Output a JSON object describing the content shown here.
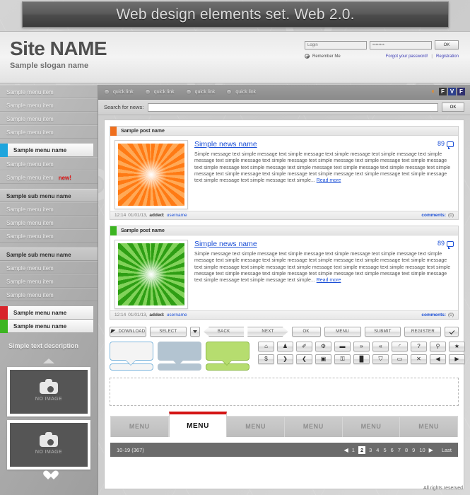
{
  "banner": {
    "title": "Web design elements set. Web 2.0."
  },
  "header": {
    "site_name": "Site NAME",
    "slogan": "Sample slogan name",
    "login": {
      "login_placeholder": "Login",
      "password_value": "••••••••",
      "ok_label": "OK",
      "remember_label": "Remember Me",
      "forgot_label": "Forgot your password!",
      "separator": "|",
      "registration_label": "Registration"
    }
  },
  "sidebar": {
    "top_items": [
      "Sample menu item",
      "Sample menu item",
      "Sample menu item",
      "Sample menu item"
    ],
    "active_item": {
      "label": "Sample menu name",
      "chip_color": "#1fa5dd"
    },
    "after_active_items": [
      {
        "label": "Sample menu item",
        "badge": ""
      },
      {
        "label": "Sample menu item",
        "badge": "new!"
      }
    ],
    "sub_sections": [
      {
        "heading": "Sample sub menu name",
        "items": [
          "Sample menu item",
          "Sample menu item",
          "Sample menu item"
        ]
      },
      {
        "heading": "Sample sub menu name",
        "items": [
          "Sample menu item",
          "Sample menu item",
          "Sample menu item"
        ]
      }
    ],
    "colored_items": [
      {
        "label": "Sample menu name",
        "chip_color": "#d8232a"
      },
      {
        "label": "Sample menu name",
        "chip_color": "#3cb521"
      }
    ],
    "description": "Simple text description",
    "no_image_label": "NO IMAGE",
    "scroll_up_icon": "chevron-up-icon",
    "scroll_down_icon": "heart-icon"
  },
  "quickbar": {
    "links": [
      "quick link",
      "quick link",
      "quick link",
      "quick link"
    ],
    "socials": [
      {
        "name": "rss-icon",
        "glyph": "◉",
        "color": "#f08a1c"
      },
      {
        "name": "facebook-icon",
        "glyph": "F",
        "color": "#3b3b3b"
      },
      {
        "name": "vkontakte-icon",
        "glyph": "V",
        "color": "#2b3f8c"
      },
      {
        "name": "flickr-icon",
        "glyph": "F",
        "color": "#2f2f6e"
      }
    ]
  },
  "search": {
    "label": "Search for news:",
    "value": "",
    "placeholder": "",
    "ok_label": "OK"
  },
  "posts": [
    {
      "head_label": "Sample post name",
      "accent": "#ef6f1e",
      "title": "Simple news name",
      "comment_count": "89",
      "text": "Simple message text simple  message text simple message text simple message text simple message text simple message text simple message text simple message text simple message text simple message text simple message text simple message text simple message text simple message text simple message text simple message text simple message text simple  message text simple message text simple message text simple message text simple message text simple message text simple message text simple... ",
      "read_more": "Read more",
      "time": "12:14",
      "date": "01/01/13,",
      "added_label": "added:",
      "username": "username",
      "comments_label": "comments:",
      "comments_value": "(0)"
    },
    {
      "head_label": "Sample post name",
      "accent": "#3cb521",
      "title": "Simple news name",
      "comment_count": "89",
      "text": "Simple message text simple  message text simple message text simple message text simple message text simple message text simple message text simple message text simple message text simple message text simple message text simple message text simple message text simple message text simple message text simple message text simple message text simple  message text simple message text simple message text simple message text simple message text simple message text simple message text simple... ",
      "read_more": "Read more",
      "time": "12:14",
      "date": "01/01/13,",
      "added_label": "added:",
      "username": "username",
      "comments_label": "comments:",
      "comments_value": "(0)"
    }
  ],
  "controls": {
    "download": "DOWNLOAD",
    "select": "SELECT",
    "back": "BACK",
    "next": "NEXT",
    "ok": "OK",
    "menu": "MENU",
    "submit": "SUBMIT",
    "register": "REGISTER",
    "check_icon": "check-icon"
  },
  "icon_buttons": {
    "row1": [
      {
        "name": "home-icon",
        "glyph": "⌂"
      },
      {
        "name": "user-icon",
        "glyph": "♟"
      },
      {
        "name": "pen-icon",
        "glyph": "✐"
      },
      {
        "name": "gear-icon",
        "glyph": "⚙"
      },
      {
        "name": "comment-icon",
        "glyph": "▬"
      },
      {
        "name": "chevron-double-down-icon",
        "glyph": "»"
      },
      {
        "name": "chevron-double-up-icon",
        "glyph": "«"
      },
      {
        "name": "rss-icon",
        "glyph": "◜"
      },
      {
        "name": "help-icon",
        "glyph": "?"
      },
      {
        "name": "search-icon",
        "glyph": "⚲"
      },
      {
        "name": "star-icon",
        "glyph": "★"
      }
    ],
    "row2": [
      {
        "name": "dollar-icon",
        "glyph": "$"
      },
      {
        "name": "chevron-right-icon",
        "glyph": "❯"
      },
      {
        "name": "chevron-left-icon",
        "glyph": "❮"
      },
      {
        "name": "save-icon",
        "glyph": "▣"
      },
      {
        "name": "lock-icon",
        "glyph": "⚿"
      },
      {
        "name": "chart-icon",
        "glyph": "█"
      },
      {
        "name": "cart-icon",
        "glyph": "⛉"
      },
      {
        "name": "camera-icon",
        "glyph": "▭"
      },
      {
        "name": "close-icon",
        "glyph": "✕"
      },
      {
        "name": "arrow-left-icon",
        "glyph": "◀"
      },
      {
        "name": "arrow-right-icon",
        "glyph": "▶"
      }
    ]
  },
  "tabs": [
    {
      "label": "MENU",
      "active": false
    },
    {
      "label": "MENU",
      "active": true
    },
    {
      "label": "MENU",
      "active": false
    },
    {
      "label": "MENU",
      "active": false
    },
    {
      "label": "MENU",
      "active": false
    },
    {
      "label": "MENU",
      "active": false
    }
  ],
  "pager": {
    "range": "10-19 (367)",
    "prev_icon": "◀",
    "next_icon": "▶",
    "pages": [
      "1",
      "2",
      "3",
      "4",
      "5",
      "6",
      "7",
      "8",
      "9",
      "10"
    ],
    "current": "2",
    "last_label": "Last"
  },
  "footer": {
    "copyright": "All rights reserved"
  },
  "colors": {
    "accent_red": "#d41414",
    "accent_blue": "#1b4fd6",
    "banner_dark": "#4b4b4b",
    "sidebar_gray": "#b4b4b4"
  }
}
